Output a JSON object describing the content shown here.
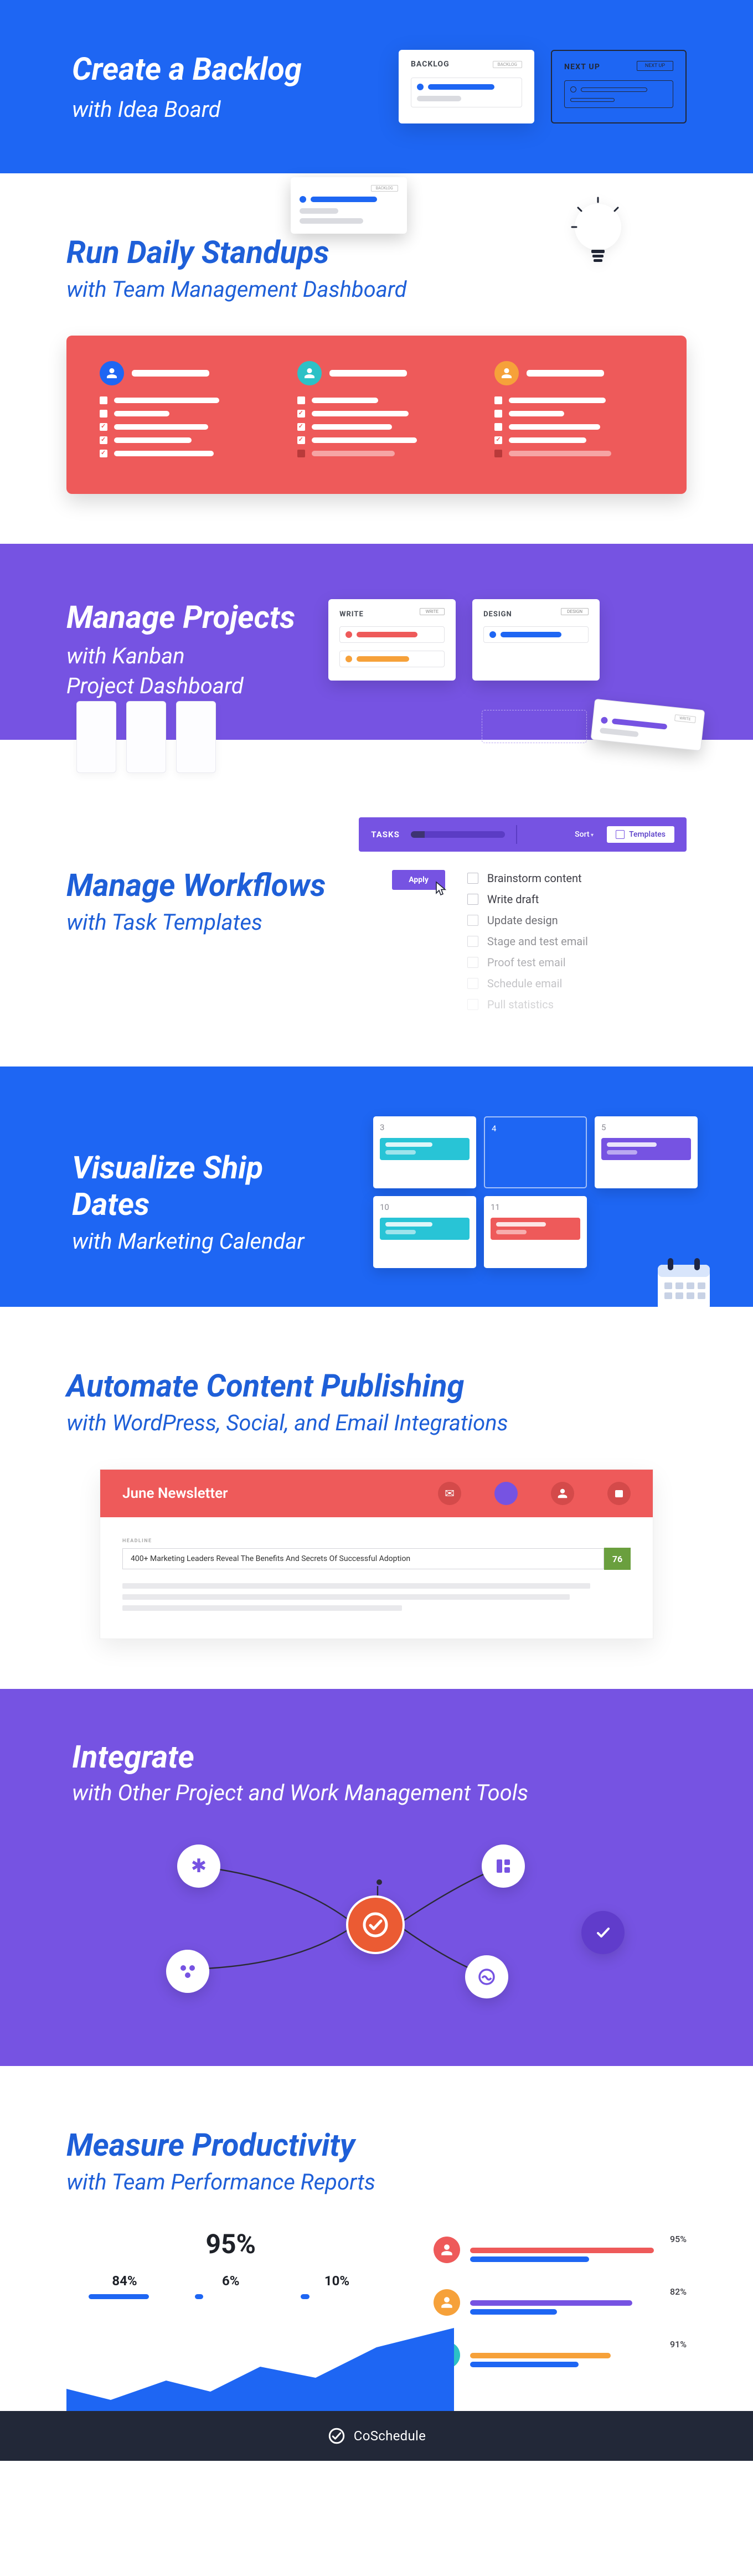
{
  "sections": {
    "backlog": {
      "heading": "Create a Backlog",
      "sub": "with Idea Board",
      "card1_label": "BACKLOG",
      "card1_tag": "BACKLOG",
      "card2_label": "NEXT UP",
      "card2_tag": "NEXT UP"
    },
    "standups": {
      "heading": "Run Daily Standups",
      "sub": "with Team Management Dashboard"
    },
    "kanban": {
      "heading": "Manage Projects",
      "sub": "with Kanban\nProject Dashboard",
      "col1_label": "WRITE",
      "col1_tag": "WRITE",
      "col2_label": "DESIGN",
      "col2_tag": "DESIGN"
    },
    "workflows": {
      "heading": "Manage Workflows",
      "sub": "with Task Templates",
      "toolbar_label": "TASKS",
      "sort_label": "Sort",
      "templates_label": "Templates",
      "apply_label": "Apply",
      "tasks": [
        {
          "label": "Brainstorm content",
          "opacity": 1.0
        },
        {
          "label": "Write draft",
          "opacity": 1.0
        },
        {
          "label": "Update design",
          "opacity": 0.75
        },
        {
          "label": "Stage and test email",
          "opacity": 0.55
        },
        {
          "label": "Proof test email",
          "opacity": 0.4
        },
        {
          "label": "Schedule email",
          "opacity": 0.3
        },
        {
          "label": "Pull statistics",
          "opacity": 0.22
        }
      ]
    },
    "shipdates": {
      "heading": "Visualize Ship Dates",
      "sub": "with Marketing Calendar",
      "days": [
        "3",
        "4",
        "5",
        "10",
        "11"
      ]
    },
    "automate": {
      "heading": "Automate Content Publishing",
      "sub": "with WordPress, Social, and Email Integrations",
      "banner_title": "June Newsletter",
      "headline_label": "HEADLINE",
      "headline_text": "400+ Marketing Leaders Reveal The Benefits And Secrets Of Successful Adoption",
      "headline_score": "76"
    },
    "integrate": {
      "heading": "Integrate",
      "sub": "with Other Project and Work Management Tools"
    },
    "productivity": {
      "heading": "Measure Productivity",
      "sub": "with Team Performance Reports",
      "overall_pct": "95%",
      "bars": [
        {
          "label": "84%",
          "w": 84
        },
        {
          "label": "6%",
          "w": 6
        },
        {
          "label": "10%",
          "w": 10
        }
      ],
      "people": [
        {
          "pct": "95%",
          "avatar": "#ee5a5a",
          "bar1": {
            "w": 85,
            "c": "#ee5a5a"
          },
          "bar2": {
            "w": 55,
            "c": "#1e66f3"
          }
        },
        {
          "pct": "82%",
          "avatar": "#f6a13a",
          "bar1": {
            "w": 75,
            "c": "#7653e2"
          },
          "bar2": {
            "w": 40,
            "c": "#1e66f3"
          }
        },
        {
          "pct": "91%",
          "avatar": "#2cc1c6",
          "bar1": {
            "w": 65,
            "c": "#f6a13a"
          },
          "bar2": {
            "w": 50,
            "c": "#1e66f3"
          }
        }
      ]
    }
  },
  "footer_brand": "CoSchedule",
  "chart_data": {
    "overall_percent": 95,
    "sub_bars": [
      {
        "value": 84,
        "unit": "%"
      },
      {
        "value": 6,
        "unit": "%"
      },
      {
        "value": 10,
        "unit": "%"
      }
    ],
    "people": [
      {
        "percent": 95
      },
      {
        "percent": 82
      },
      {
        "percent": 91
      }
    ],
    "type": "bar"
  }
}
